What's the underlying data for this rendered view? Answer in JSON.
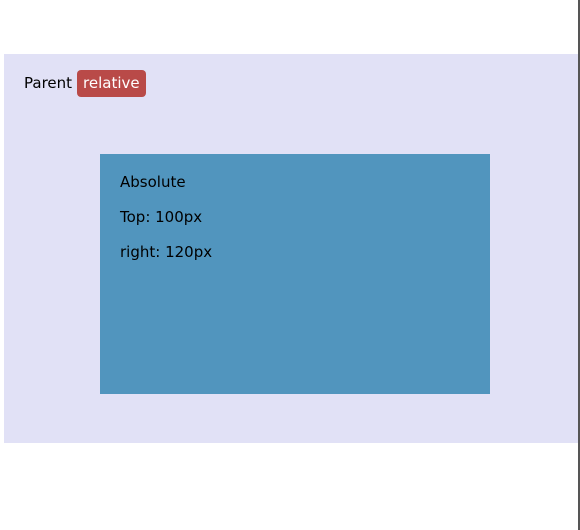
{
  "parent": {
    "label": "Parent",
    "badge": "relative",
    "colors": {
      "background": "#e1e1f6",
      "badge_background": "#b94a48",
      "badge_text": "#ffffff"
    }
  },
  "absolute_box": {
    "lines": [
      "Absolute",
      "Top: 100px",
      "right: 120px"
    ],
    "colors": {
      "background": "#5195be",
      "text": "#000000"
    }
  }
}
